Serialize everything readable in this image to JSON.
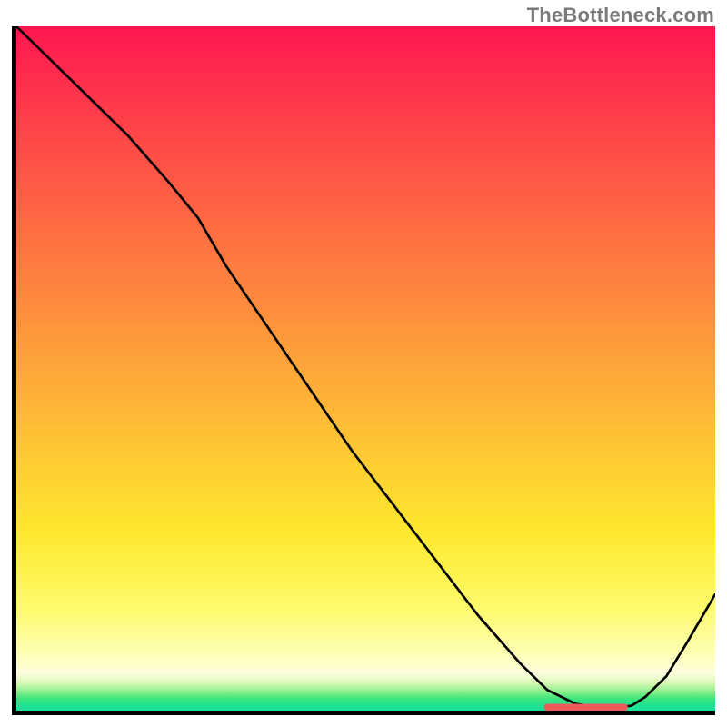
{
  "watermark": "TheBottleneck.com",
  "chart_data": {
    "type": "line",
    "title": "",
    "xlabel": "",
    "ylabel": "",
    "xlim": [
      0,
      100
    ],
    "ylim": [
      0,
      100
    ],
    "grid": false,
    "legend": false,
    "series": [
      {
        "name": "curve",
        "x": [
          0,
          4,
          10,
          16,
          22,
          26,
          30,
          36,
          42,
          48,
          54,
          60,
          66,
          72,
          76,
          80,
          83,
          86,
          88,
          90,
          93,
          96,
          100
        ],
        "values": [
          100,
          96,
          90,
          84,
          77,
          72,
          65,
          56,
          47,
          38,
          30,
          22,
          14,
          7,
          3,
          1,
          0.5,
          0.5,
          0.7,
          2,
          5,
          10,
          17
        ]
      }
    ],
    "annotations": [
      {
        "name": "marker-strip",
        "type": "segment",
        "x_start": 76,
        "x_end": 87,
        "y": 0.5,
        "color": "#ed5a5a"
      }
    ],
    "background_gradient": {
      "direction": "top-to-bottom",
      "stops": [
        {
          "pos": 0.0,
          "color": "#fe1651"
        },
        {
          "pos": 0.28,
          "color": "#fe6843"
        },
        {
          "pos": 0.6,
          "color": "#fec235"
        },
        {
          "pos": 0.85,
          "color": "#fefb6b"
        },
        {
          "pos": 0.95,
          "color": "#fefee0"
        },
        {
          "pos": 1.0,
          "color": "#18e0a0"
        }
      ]
    }
  }
}
